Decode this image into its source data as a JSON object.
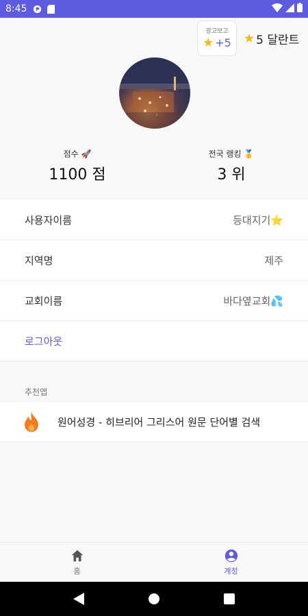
{
  "status_bar": {
    "time": "8:45",
    "icons": [
      "pocket-icon",
      "sd-card-icon",
      "wifi-icon",
      "signal-icon",
      "battery-icon"
    ]
  },
  "ad_reward": {
    "label": "광고보고",
    "reward": "+5",
    "icon": "star-icon"
  },
  "talent": {
    "label": "5 달란트",
    "icon": "star-icon"
  },
  "profile": {
    "avatar": "city-night-photo"
  },
  "stats": {
    "score_label": "점수 🚀",
    "score_value": "1100 점",
    "rank_label": "전국 랭킹 🥇",
    "rank_value": "3 위"
  },
  "info": {
    "username_label": "사용자이름",
    "username_value": "등대지기⭐",
    "region_label": "지역명",
    "region_value": "제주",
    "church_label": "교회이름",
    "church_value": "바다옆교회💦",
    "logout_label": "로그아웃"
  },
  "recommended": {
    "section_label": "추천앱",
    "app_title": "원어성경 - 히브리어 그리스어 원문 단어별 검색",
    "app_icon": "flame-icon"
  },
  "bottom_nav": {
    "home_label": "홈",
    "account_label": "계정",
    "active": "account"
  },
  "colors": {
    "accent": "#5d5be0",
    "star": "#f5b81a",
    "flame": "#f57c1f"
  }
}
